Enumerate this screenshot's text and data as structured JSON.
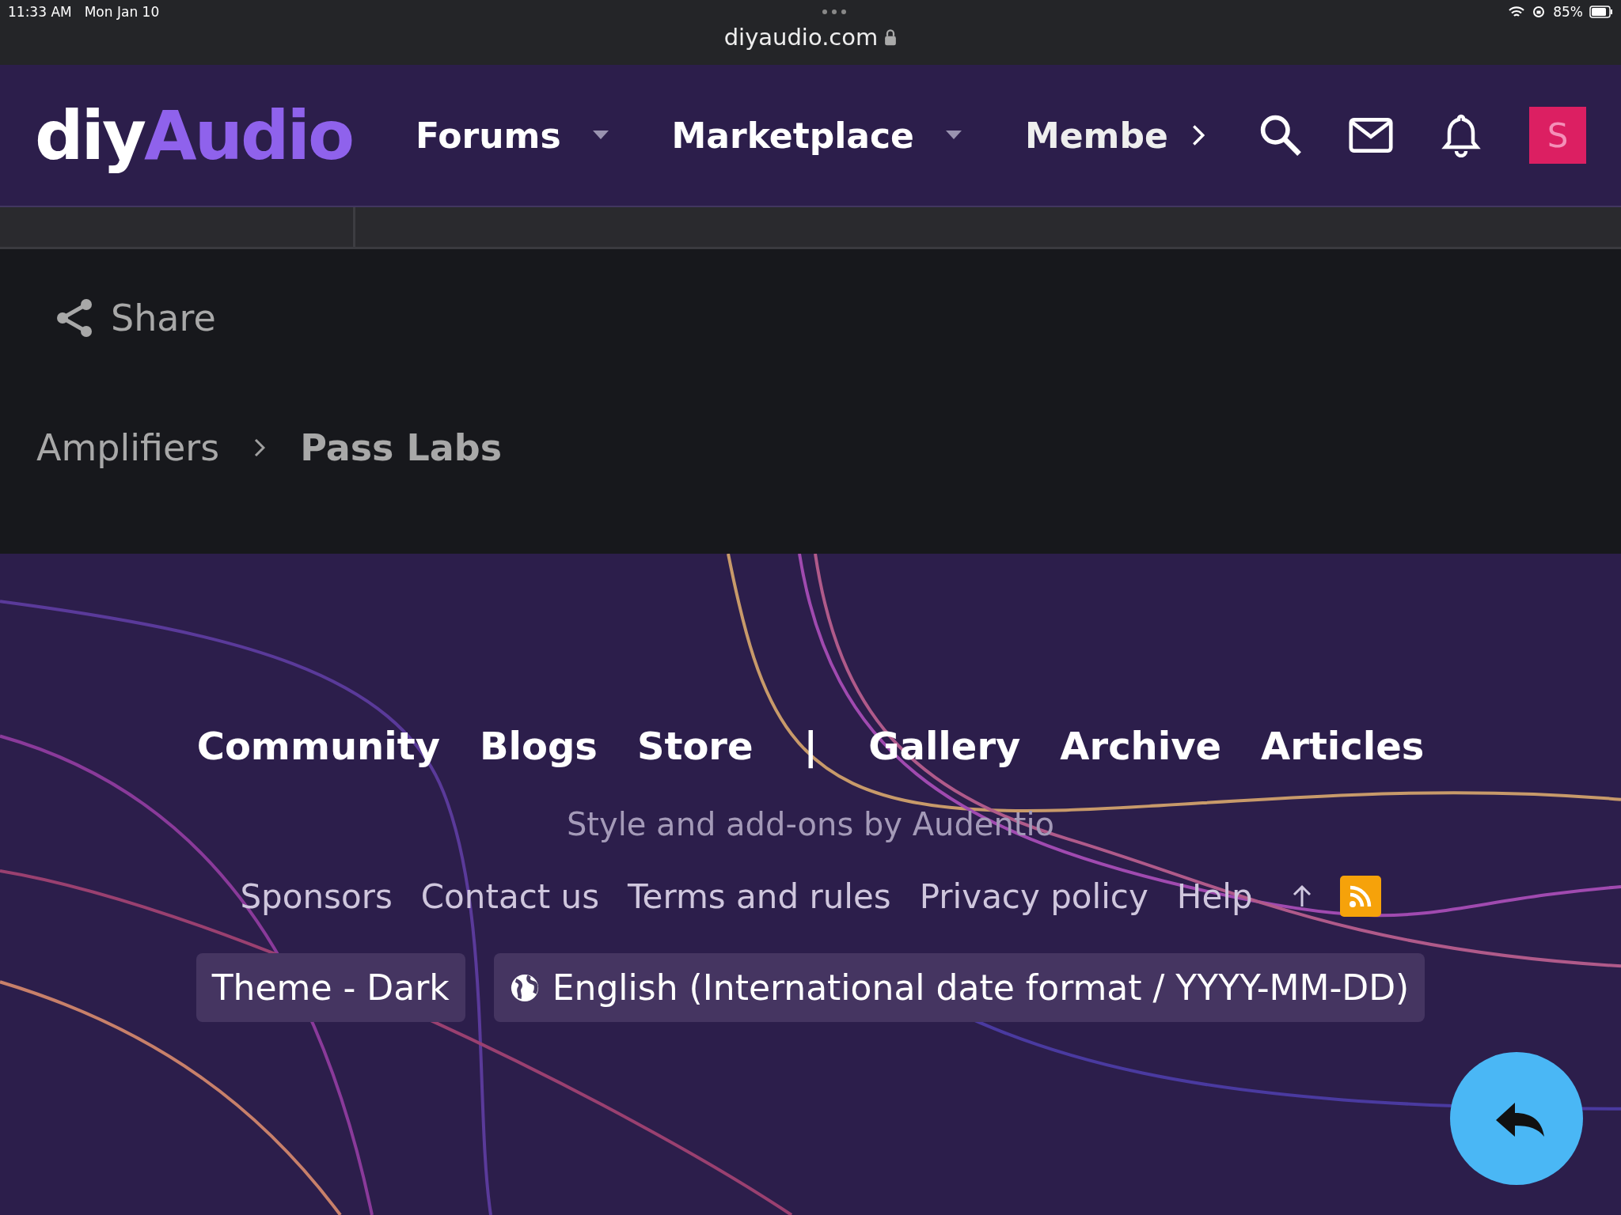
{
  "status_bar": {
    "time": "11:33 AM",
    "date": "Mon Jan 10",
    "battery": "85%",
    "url": "diyaudio.com"
  },
  "header": {
    "logo": {
      "part_1": "diy",
      "part_2": "Audio"
    },
    "nav": [
      {
        "label": "Forums",
        "kind": "dropdown"
      },
      {
        "label": "Marketplace",
        "kind": "dropdown"
      },
      {
        "label": "Membe",
        "kind": "more"
      }
    ],
    "avatar_letter": "S"
  },
  "share": "Share",
  "breadcrumb": [
    {
      "label": "Amplifiers",
      "current": false
    },
    {
      "label": "Pass Labs",
      "current": true
    }
  ],
  "footer": {
    "nav": [
      {
        "label": "Community",
        "kind": "link"
      },
      {
        "label": "Blogs",
        "kind": "link"
      },
      {
        "label": "Store",
        "kind": "link"
      },
      {
        "label": "|",
        "kind": "separator"
      },
      {
        "label": "Gallery",
        "kind": "link"
      },
      {
        "label": "Archive",
        "kind": "link"
      },
      {
        "label": "Articles",
        "kind": "link"
      }
    ],
    "credit": "Style and add-ons by Audentio",
    "links": [
      "Sponsors",
      "Contact us",
      "Terms and rules",
      "Privacy policy",
      "Help"
    ],
    "theme": "Theme - Dark",
    "language": "English (International date format / YYYY-MM-DD)"
  }
}
